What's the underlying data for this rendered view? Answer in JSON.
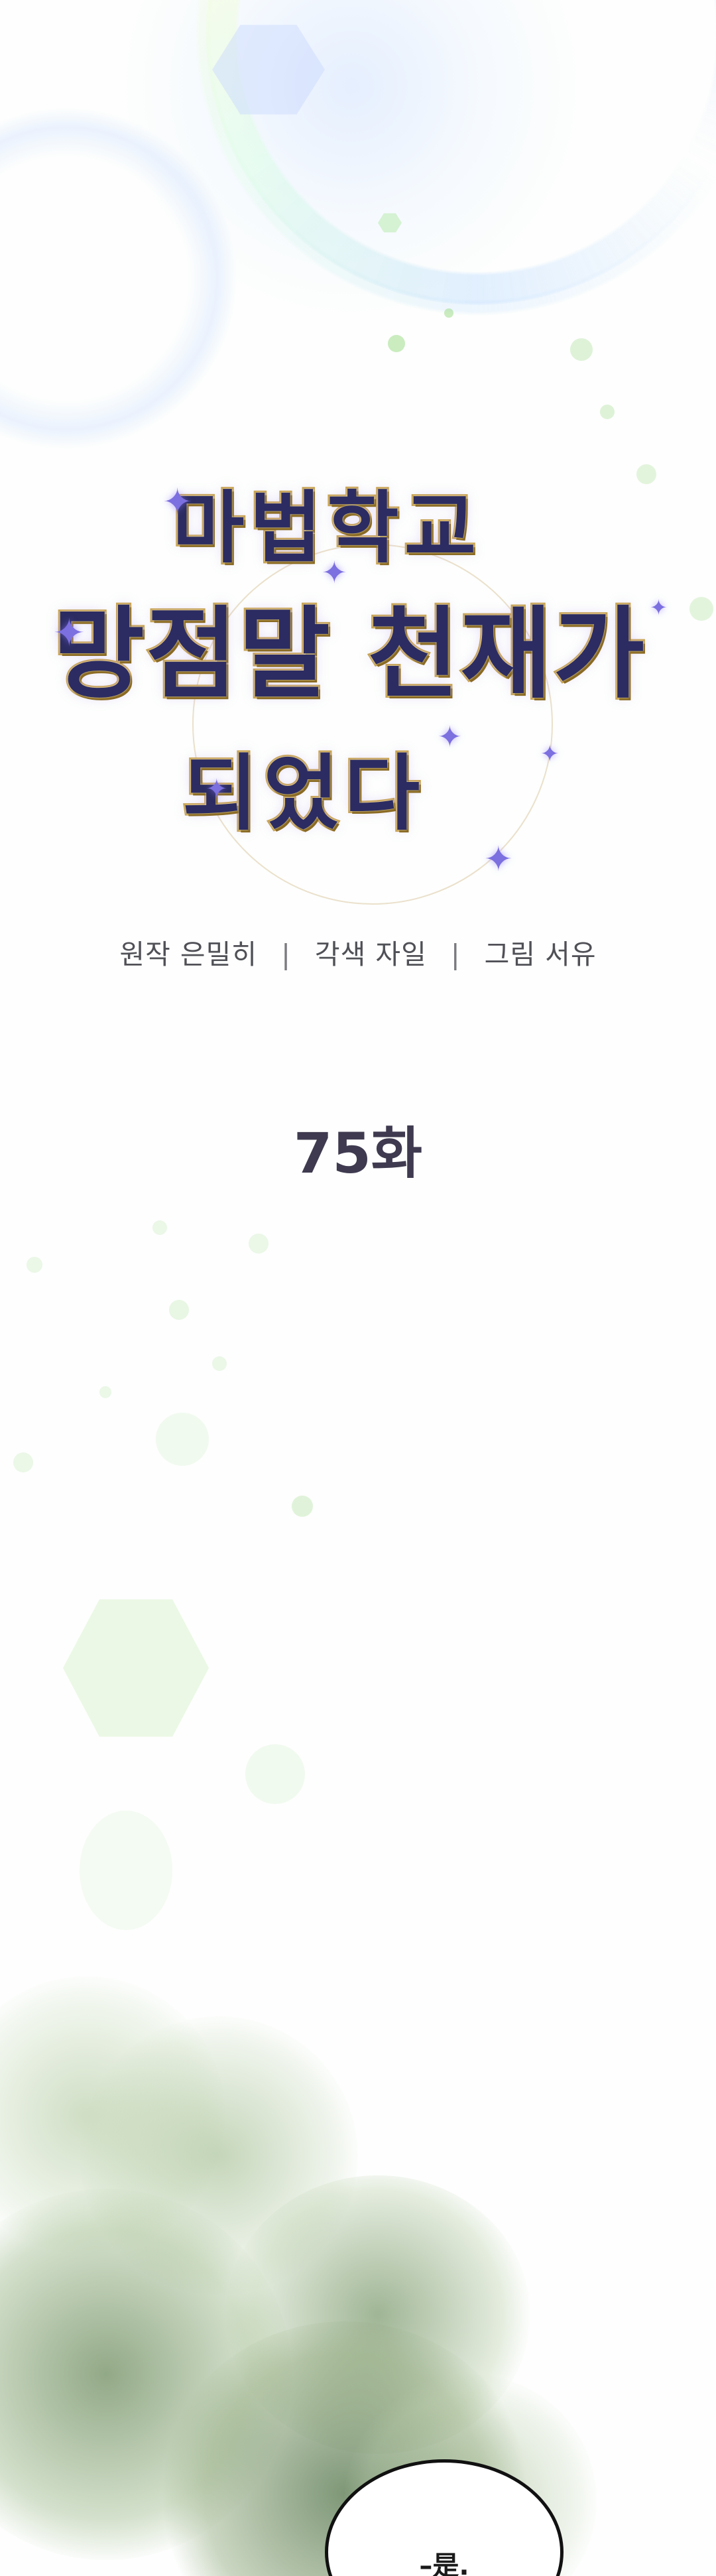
{
  "title": {
    "line1": "마법학교",
    "line2": "망점말 천재가",
    "line3": "되었다"
  },
  "credits": {
    "original": "원작 은밀히",
    "adaptation": "각색 자일",
    "art": "그림 서유",
    "separator": "|"
  },
  "episode": "75화",
  "dialogue": {
    "bubble_text": "–是."
  },
  "colors": {
    "title_fill": "#2c2c62",
    "title_outline": "#c9a54a",
    "credits_text": "#505057",
    "episode_text": "#3f3a4f",
    "bubble_border": "#111111"
  },
  "icons": {
    "sparkle": "✦"
  }
}
